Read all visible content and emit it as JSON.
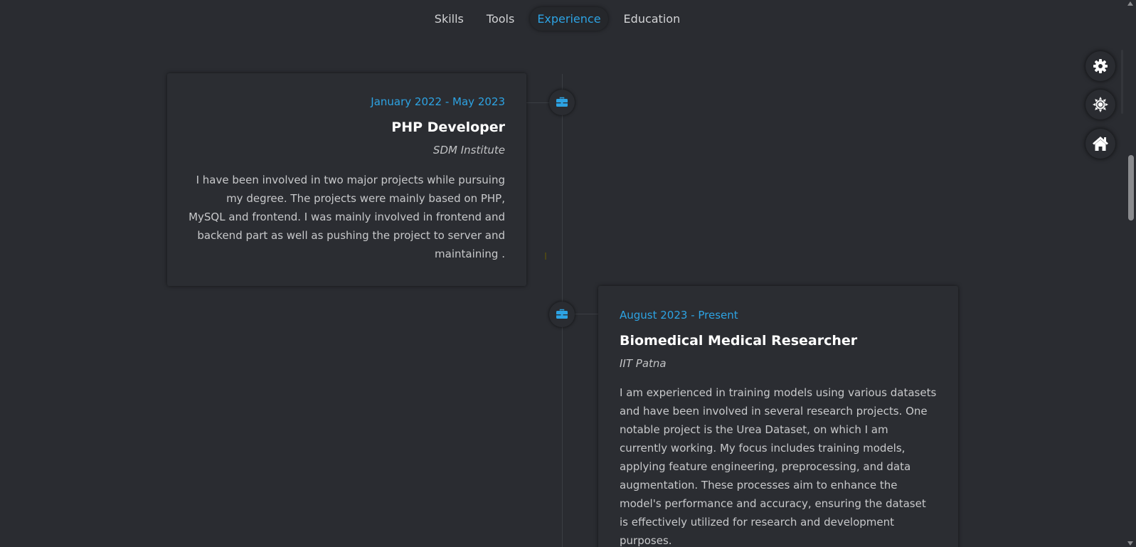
{
  "nav": {
    "items": [
      {
        "label": "Skills",
        "active": false
      },
      {
        "label": "Tools",
        "active": false
      },
      {
        "label": "Experience",
        "active": true
      },
      {
        "label": "Education",
        "active": false
      }
    ]
  },
  "timeline": {
    "entries": [
      {
        "date": "January 2022 - May 2023",
        "title": "PHP Developer",
        "organization": "SDM Institute",
        "description": "I have been involved in two major projects while pursuing my degree. The projects were mainly based on PHP, MySQL and frontend. I was mainly involved in frontend and backend part as well as pushing the project to server and maintaining .",
        "icon": "briefcase-icon",
        "side": "left"
      },
      {
        "date": "August 2023 - Present",
        "title": "Biomedical Medical Researcher",
        "organization": "IIT Patna",
        "description": "I am experienced in training models using various datasets and have been involved in several research projects. One notable project is the Urea Dataset, on which I am currently working. My focus includes training models, applying feature engineering, preprocessing, and data augmentation. These processes aim to enhance the model's performance and accuracy, ensuring the dataset is effectively utilized for research and development purposes.",
        "icon": "briefcase-icon",
        "side": "right"
      }
    ]
  },
  "side_buttons": [
    {
      "icon": "gear-icon"
    },
    {
      "icon": "sun-icon"
    },
    {
      "icon": "home-icon"
    }
  ],
  "colors": {
    "background": "#2a2c31",
    "accent": "#2da3e3",
    "card": "#2b2d32",
    "text": "#c8c9cb",
    "title": "#ffffff"
  }
}
